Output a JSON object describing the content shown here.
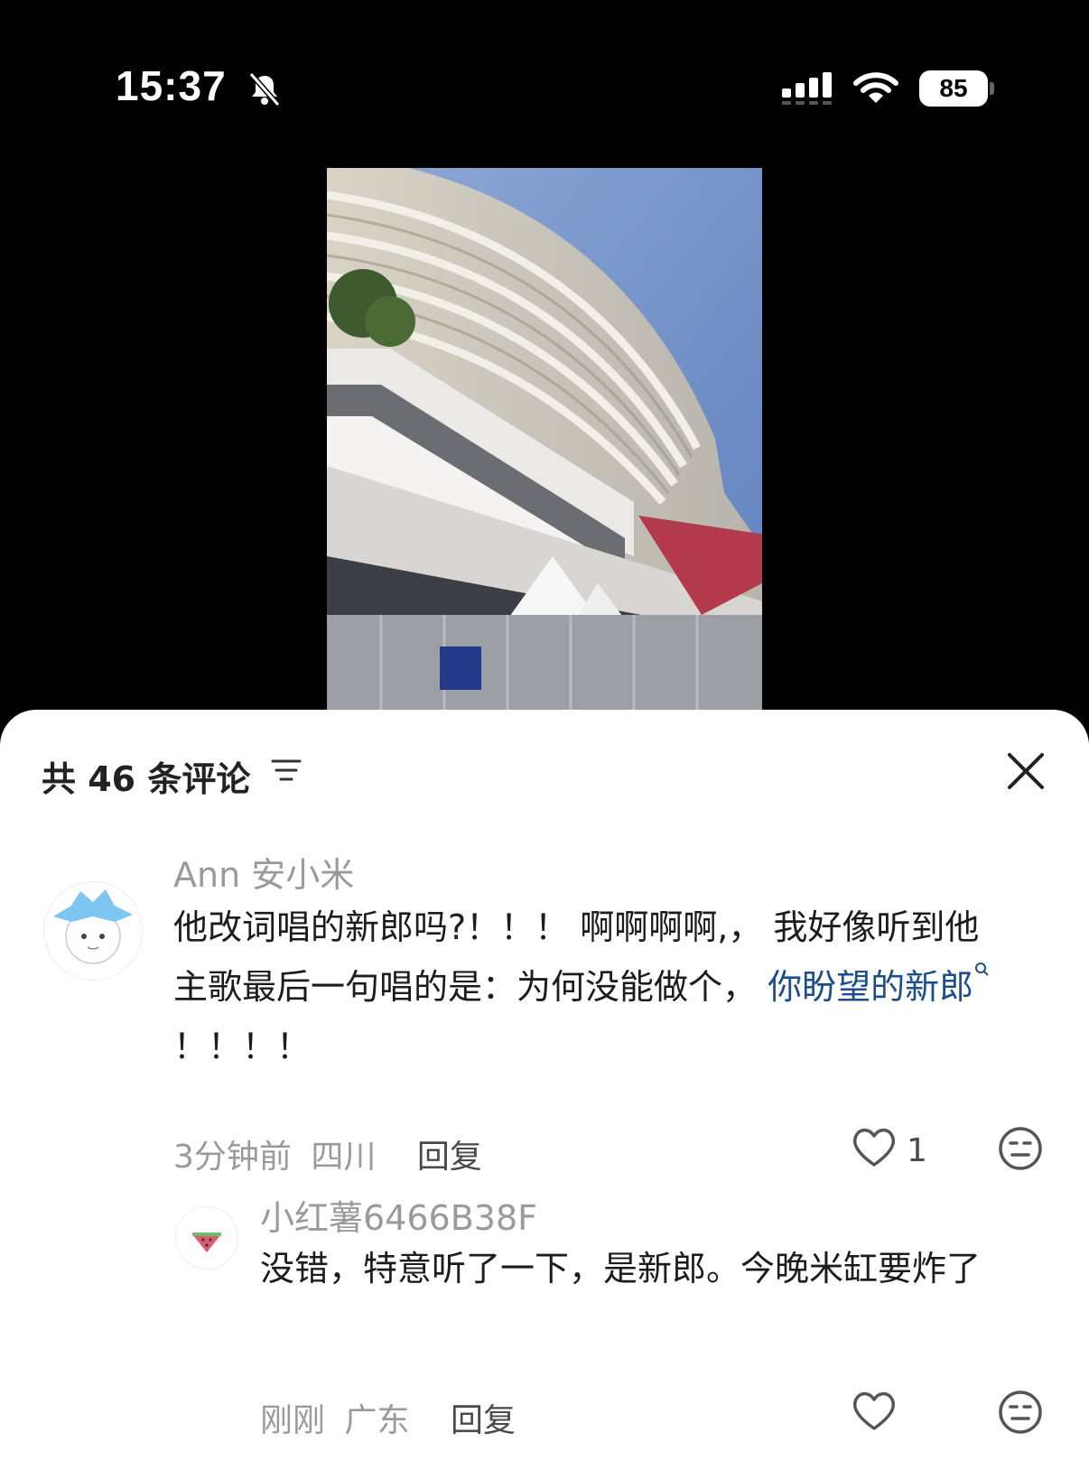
{
  "status_bar": {
    "time": "15:37",
    "battery": "85"
  },
  "comments_panel": {
    "title": "共 46 条评论",
    "comments": [
      {
        "user": "Ann 安小米",
        "text_part1": "他改词唱的新郎吗?！！！ 啊啊啊啊,， 我好像听到他主歌最后一句唱的是：为何没能做个，",
        "mention": "你盼望的新郎",
        "text_part2": "！！！！",
        "time": "3分钟前",
        "location": "四川",
        "reply_label": "回复",
        "likes": "1"
      },
      {
        "user": "小红薯6466B38F",
        "text": "没错，特意听了一下，是新郎。今晚米缸要炸了",
        "time": "刚刚",
        "location": "广东",
        "reply_label": "回复"
      }
    ]
  },
  "icons": {
    "mute": "bell-slash-icon",
    "sort": "sort-icon",
    "close": "close-icon",
    "like": "heart-icon",
    "emoji": "neutral-face-icon",
    "search_mention": "search-icon"
  }
}
